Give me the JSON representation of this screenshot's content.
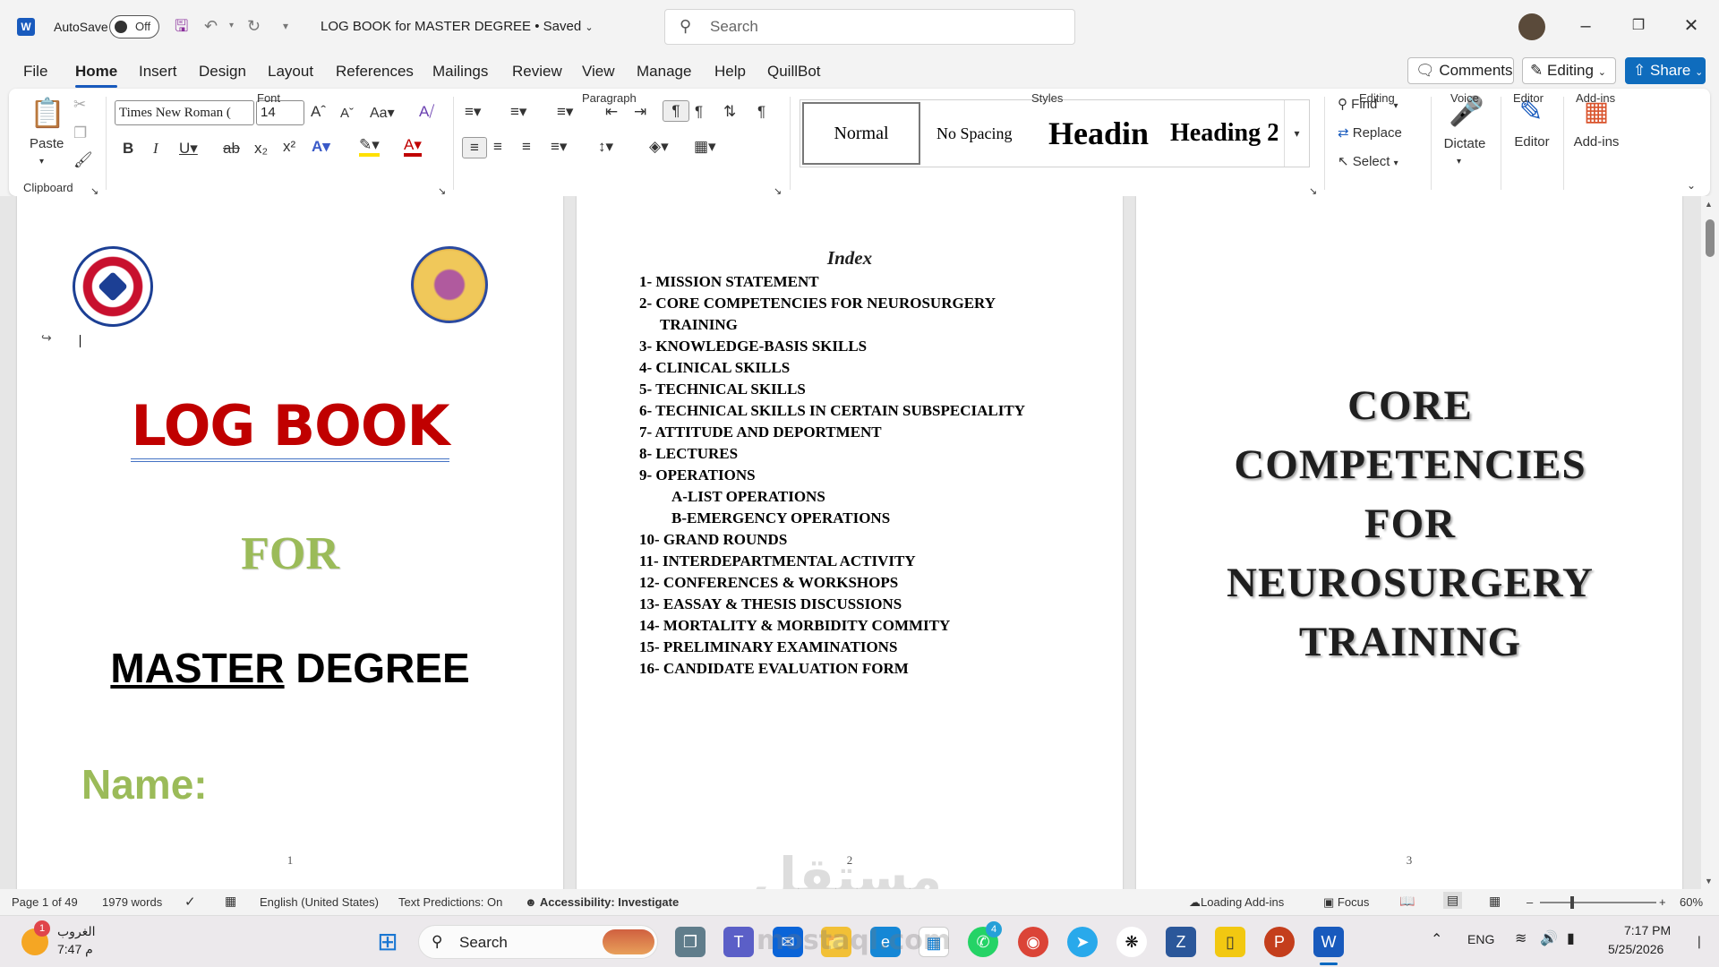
{
  "titlebar": {
    "app_icon": "word-icon",
    "autosave_label": "AutoSave",
    "autosave_state": "Off",
    "doc_title": "LOG BOOK for MASTER DEGREE",
    "saved_status": "• Saved",
    "search_placeholder": "Search"
  },
  "tabs": [
    "File",
    "Home",
    "Insert",
    "Design",
    "Layout",
    "References",
    "Mailings",
    "Review",
    "View",
    "Manage",
    "Help",
    "QuillBot"
  ],
  "active_tab": "Home",
  "right_buttons": {
    "comments": "Comments",
    "editing": "Editing",
    "share": "Share"
  },
  "ribbon": {
    "clipboard": {
      "paste": "Paste",
      "label": "Clipboard"
    },
    "font": {
      "name": "Times New Roman (",
      "size": "14",
      "label": "Font"
    },
    "paragraph": {
      "label": "Paragraph"
    },
    "styles": {
      "items": [
        "Normal",
        "No Spacing",
        "Headin",
        "Heading 2"
      ],
      "label": "Styles"
    },
    "editing": {
      "find": "Find",
      "replace": "Replace",
      "select": "Select",
      "label": "Editing"
    },
    "voice": {
      "dictate": "Dictate",
      "label": "Voice"
    },
    "editor": {
      "editor": "Editor",
      "label": "Editor"
    },
    "addins": {
      "addins": "Add-ins",
      "label": "Add-ins"
    }
  },
  "pages": {
    "p1": {
      "title_line1": "LOG BOOK",
      "for": "FOR",
      "master_underlined": "MASTER",
      "degree": " DEGREE",
      "name_label": "Name:",
      "page_number": "1"
    },
    "p2": {
      "heading": "Index",
      "items": [
        "1- MISSION STATEMENT",
        "2- CORE COMPETENCIES FOR NEUROSURGERY",
        "TRAINING",
        "3- KNOWLEDGE-BASIS SKILLS",
        "4- CLINICAL SKILLS",
        "5- TECHNICAL SKILLS",
        "6- TECHNICAL SKILLS IN CERTAIN SUBSPECIALITY",
        "7- ATTITUDE AND DEPORTMENT",
        "8- LECTURES",
        "9- OPERATIONS",
        "A-LIST OPERATIONS",
        "B-EMERGENCY OPERATIONS",
        "10- GRAND ROUNDS",
        "11- INTERDEPARTMENTAL ACTIVITY",
        "12- CONFERENCES & WORKSHOPS",
        "13- EASSAY & THESIS DISCUSSIONS",
        "14- MORTALITY & MORBIDITY COMMITY",
        "15- PRELIMINARY EXAMINATIONS",
        "16- CANDIDATE EVALUATION FORM"
      ],
      "page_number": "2"
    },
    "p3": {
      "lines": [
        "CORE",
        "COMPETENCIES",
        "FOR",
        "NEUROSURGERY",
        "TRAINING"
      ],
      "page_number": "3"
    }
  },
  "statusbar": {
    "page": "Page 1 of 49",
    "words": "1979 words",
    "language": "English (United States)",
    "predictions": "Text Predictions: On",
    "accessibility": "Accessibility: Investigate",
    "addins": "Loading Add-ins",
    "focus": "Focus",
    "zoom": "60%"
  },
  "taskbar": {
    "weather_label": "الغروب",
    "weather_time": "7:47 م",
    "weather_badge": "1",
    "search": "Search",
    "lang": "ENG",
    "time": "7:17 PM",
    "date": "5/25/2026",
    "whatsapp_badge": "4"
  },
  "watermark": {
    "arabic": "مستقل",
    "latin": "mostaql.com"
  },
  "colors": {
    "accent": "#185abd",
    "share": "#0f6cbd",
    "logbook_red": "#c00000",
    "for_green": "#9bbb59"
  }
}
